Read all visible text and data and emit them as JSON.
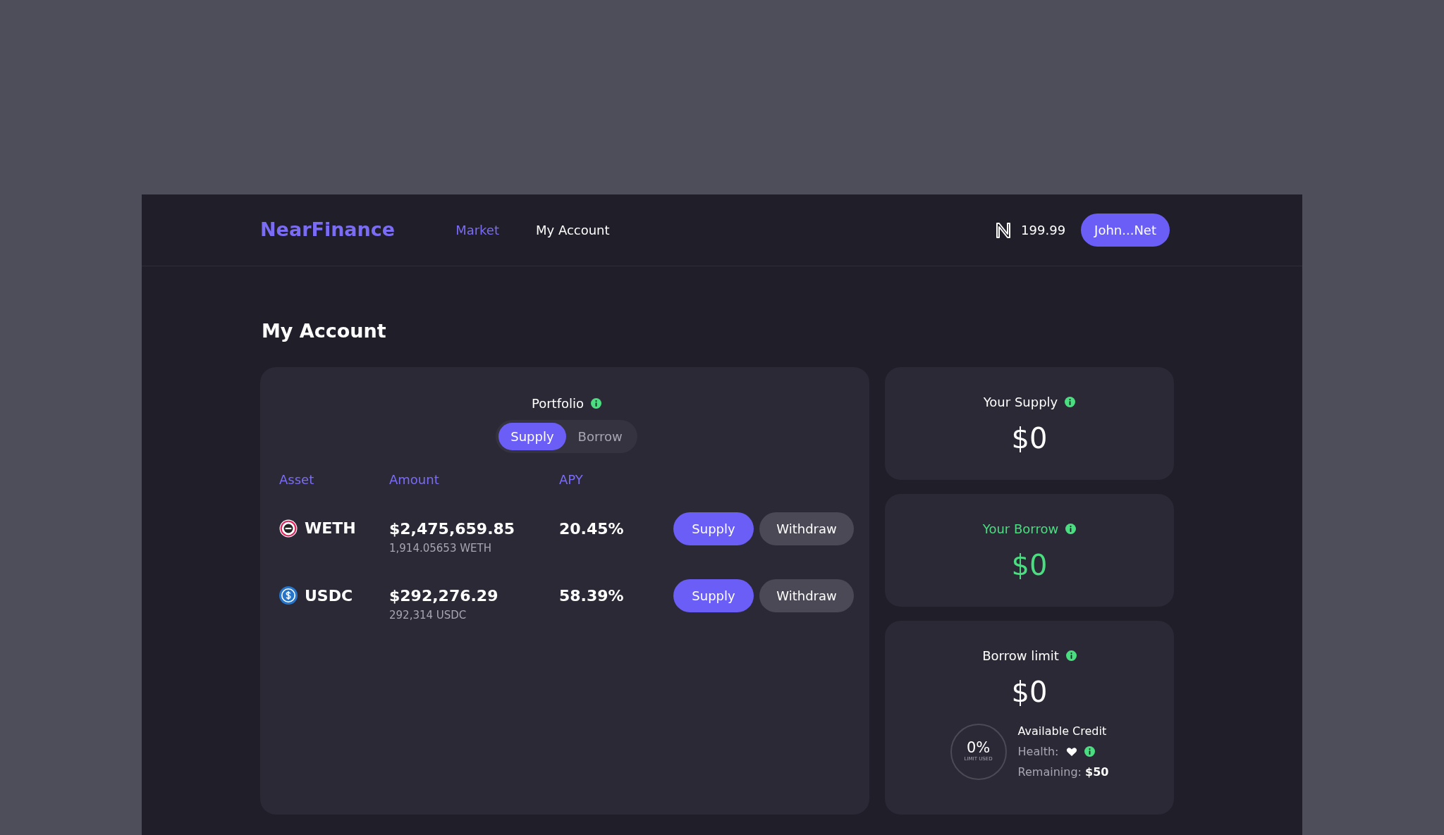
{
  "brand": "NearFinance",
  "nav": [
    {
      "label": "Market",
      "selected": true
    },
    {
      "label": "My Account",
      "selected": false
    }
  ],
  "balance": "199.99",
  "account_button": "John...Net",
  "page_title": "My Account",
  "portfolio": {
    "title": "Portfolio",
    "toggle": [
      {
        "label": "Supply",
        "selected": true
      },
      {
        "label": "Borrow",
        "selected": false
      }
    ],
    "columns": [
      "Asset",
      "Amount",
      "APY"
    ],
    "rows": [
      {
        "asset": "WETH",
        "kind": "weth",
        "amount": "$2,475,659.85",
        "sub_amount": "1,914.05653 WETH",
        "apy": "20.45%",
        "buttons": [
          "Supply",
          "Withdraw"
        ]
      },
      {
        "asset": "USDC",
        "kind": "usdc",
        "amount": "$292,276.29",
        "sub_amount": "292,314 USDC",
        "apy": "58.39%",
        "buttons": [
          "Supply",
          "Withdraw"
        ]
      }
    ]
  },
  "summary": [
    {
      "title": "Your Supply",
      "value": "$0",
      "color": "#ffffff"
    },
    {
      "title": "Your Borrow",
      "value": "$0",
      "color": "#4ade80"
    },
    {
      "title": "Borrow limit",
      "value": "$0",
      "color": "#ffffff",
      "credit": {
        "gauge_value": "0%",
        "gauge_label": "LIMIT USED",
        "heading": "Available Credit",
        "health_label": "Health:",
        "remaining": "Remaining: **$50**"
      }
    }
  ]
}
